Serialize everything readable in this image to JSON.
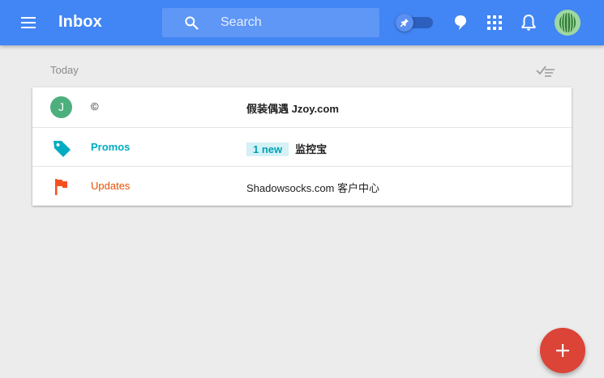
{
  "header": {
    "title": "Inbox",
    "search": {
      "placeholder": "Search",
      "value": ""
    },
    "pin_toggle": {
      "state": "on"
    },
    "icons": {
      "menu": "hamburger-menu-icon",
      "search": "search-icon",
      "pin": "pin-icon",
      "reminder": "speech-bubble-icon",
      "apps": "apps-grid-icon",
      "notifications": "bell-icon",
      "account": "watermelon-avatar-icon"
    },
    "colors": {
      "bar": "#4285f4"
    }
  },
  "section": {
    "label": "Today",
    "sweep_icon": "sweep-done-icon"
  },
  "rows": [
    {
      "kind": "conversation",
      "avatar_letter": "J",
      "avatar_color": "#4caf7d",
      "sender": "©",
      "snippet": "假装偶遇 Jzoy.com"
    },
    {
      "kind": "bundle",
      "icon": "tag-icon",
      "icon_color": "#00acc1",
      "sender": "Promos",
      "badge": "1 new",
      "snippet": "监控宝"
    },
    {
      "kind": "bundle",
      "icon": "flag-icon",
      "icon_color": "#f4511e",
      "sender": "Updates",
      "snippet": "Shadowsocks.com 客户中心"
    }
  ],
  "fab": {
    "icon": "plus-icon",
    "color": "#db4437"
  }
}
